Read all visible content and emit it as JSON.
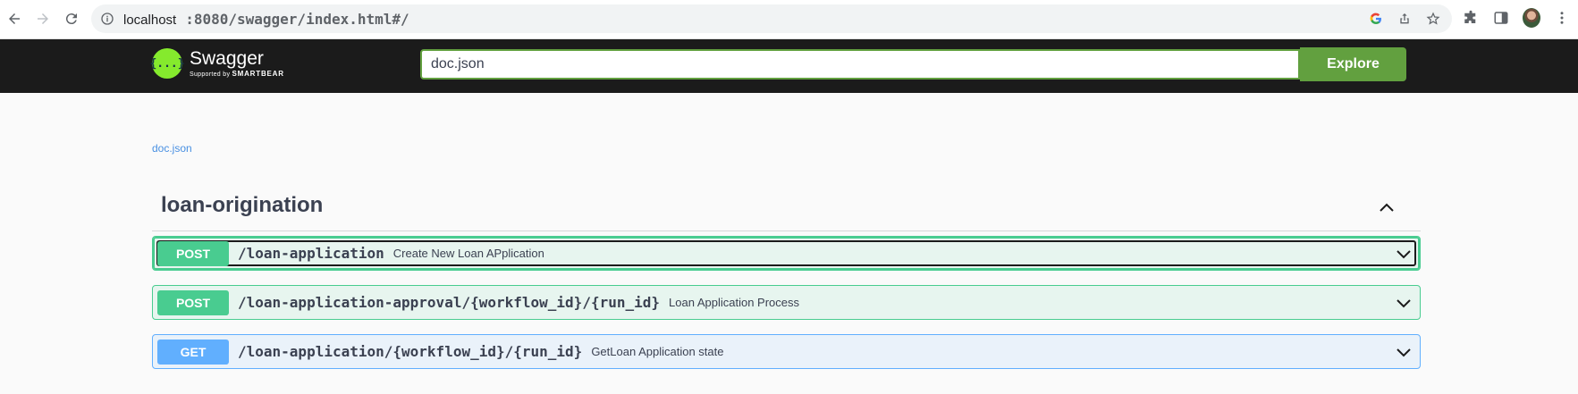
{
  "browser": {
    "url_host": "localhost",
    "url_path": ":8080/swagger/index.html#/"
  },
  "topbar": {
    "logo_title": "Swagger",
    "logo_supported_by": "Supported by",
    "logo_company": "SMARTBEAR",
    "spec_url_value": "doc.json",
    "explore_label": "Explore"
  },
  "main": {
    "doc_link": "doc.json",
    "tag": {
      "name": "loan-origination",
      "operations": [
        {
          "method": "POST",
          "path": "/loan-application",
          "summary": "Create New Loan APplication"
        },
        {
          "method": "POST",
          "path": "/loan-application-approval/{workflow_id}/{run_id}",
          "summary": "Loan Application Process"
        },
        {
          "method": "GET",
          "path": "/loan-application/{workflow_id}/{run_id}",
          "summary": "GetLoan Application state"
        }
      ]
    }
  },
  "colors": {
    "post": "#49cc90",
    "get": "#61affe",
    "explore": "#62a03f",
    "topbar": "#1b1b1b"
  }
}
